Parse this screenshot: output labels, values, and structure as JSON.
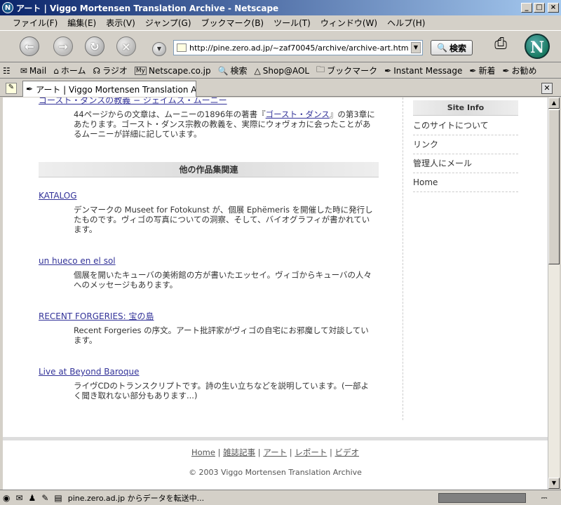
{
  "window": {
    "title": "アート | Viggo Mortensen Translation Archive - Netscape",
    "minimize": "_",
    "maximize": "□",
    "close": "×"
  },
  "menu": [
    "ファイル(F)",
    "編集(E)",
    "表示(V)",
    "ジャンプ(G)",
    "ブックマーク(B)",
    "ツール(T)",
    "ウィンドウ(W)",
    "ヘルプ(H)"
  ],
  "nav": {
    "url": "http://pine.zero.ad.jp/~zaf70045/archive/archive-art.htm",
    "search_label": "検索"
  },
  "personal_toolbar": [
    {
      "icon": "mail-icon",
      "label": "Mail"
    },
    {
      "icon": "home-icon",
      "label": "ホーム"
    },
    {
      "icon": "radio-icon",
      "label": "ラジオ"
    },
    {
      "icon": "my-icon",
      "label": "Netscape.co.jp"
    },
    {
      "icon": "search-icon",
      "label": "検索"
    },
    {
      "icon": "aol-icon",
      "label": "Shop@AOL"
    },
    {
      "icon": "folder-icon",
      "label": "ブックマーク"
    },
    {
      "icon": "bookmark-icon",
      "label": "Instant Message"
    },
    {
      "icon": "bookmark-icon",
      "label": "新着"
    },
    {
      "icon": "bookmark-icon",
      "label": "お勧め"
    }
  ],
  "tab": {
    "label": "アート | Viggo Mortensen Translation Arch..."
  },
  "content": {
    "top_link": "ゴースト・ダンスの教義 − ジェイムス・ムーニー",
    "top_desc_1": "44ページからの文章は、ムーニーの1896年の著書『",
    "top_desc_link": "ゴースト・ダンス",
    "top_desc_2": "』の第3章にあたります。ゴースト・ダンス宗教の教義を、実際にウォヴォカに会ったことがあるムーニーが詳細に記しています。",
    "section_title": "他の作品集関連",
    "items": [
      {
        "title": "KATALOG",
        "desc": "デンマークの Museet for Fotokunst が、個展 Ephëmeris を開催した時に発行したものです。ヴィゴの写真についての洞察、そして、バイオグラフィが書かれています。"
      },
      {
        "title": "un hueco en el sol",
        "desc": "個展を開いたキューバの美術館の方が書いたエッセイ。ヴィゴからキューバの人々へのメッセージもあります。"
      },
      {
        "title": "RECENT FORGERIES: 宝の島",
        "desc": "Recent Forgeries の序文。アート批評家がヴィゴの自宅にお邪魔して対談しています。"
      },
      {
        "title": "Live at Beyond Baroque",
        "desc": "ライヴCDのトランスクリプトです。詩の生い立ちなどを説明しています。(一部よく聞き取れない部分もあります...)"
      }
    ]
  },
  "sidebar": {
    "title": "Site Info",
    "items": [
      "このサイトについて",
      "リンク",
      "管理人にメール",
      "Home"
    ]
  },
  "footer": {
    "links": [
      "Home",
      "雑誌記事",
      "アート",
      "レポート",
      "ビデオ"
    ],
    "separator": "|",
    "copyright": "© 2003 Viggo Mortensen Translation Archive"
  },
  "status": {
    "text": "pine.zero.ad.jp からデータを転送中..."
  }
}
